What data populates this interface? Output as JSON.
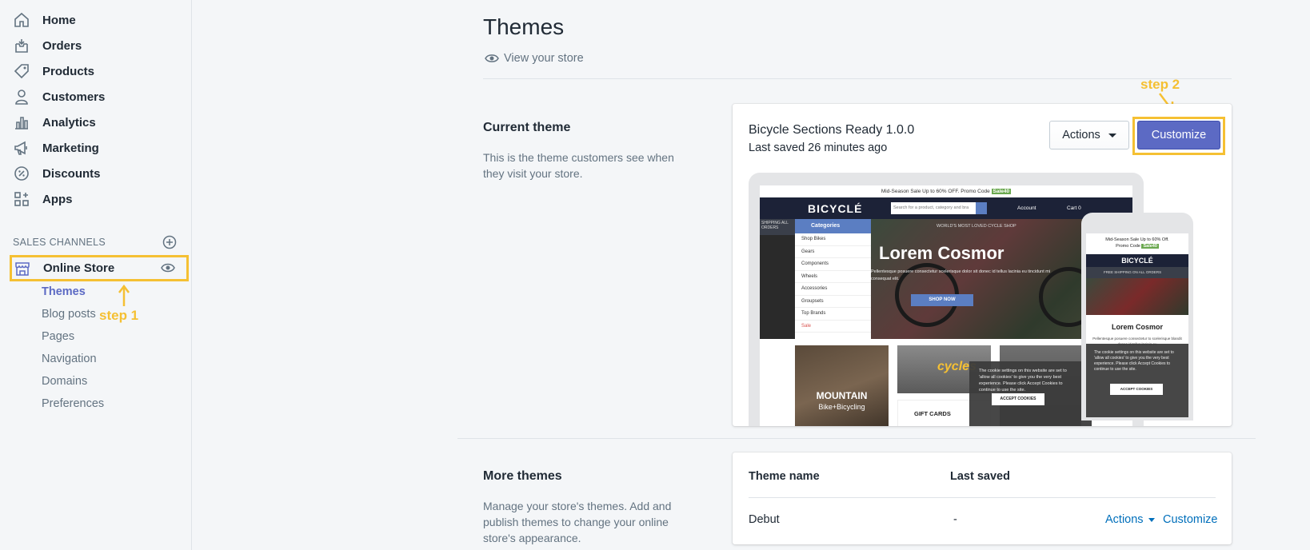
{
  "sidebar": {
    "items": [
      {
        "label": "Home",
        "icon": "home-icon"
      },
      {
        "label": "Orders",
        "icon": "orders-icon"
      },
      {
        "label": "Products",
        "icon": "tag-icon"
      },
      {
        "label": "Customers",
        "icon": "person-icon"
      },
      {
        "label": "Analytics",
        "icon": "bar-chart-icon"
      },
      {
        "label": "Marketing",
        "icon": "megaphone-icon"
      },
      {
        "label": "Discounts",
        "icon": "discount-icon"
      },
      {
        "label": "Apps",
        "icon": "apps-icon"
      }
    ],
    "sales_channels_label": "SALES CHANNELS",
    "online_store_label": "Online Store",
    "sub_items": [
      "Themes",
      "Blog posts",
      "Pages",
      "Navigation",
      "Domains",
      "Preferences"
    ],
    "active_sub": "Themes"
  },
  "annotations": {
    "step1": "step 1",
    "step2": "step 2",
    "color": "#f5c033"
  },
  "main": {
    "title": "Themes",
    "view_store": "View your store",
    "current": {
      "heading": "Current theme",
      "description": "This is the theme customers see when they visit your store.",
      "theme_name": "Bicycle Sections Ready 1.0.0",
      "last_saved": "Last saved 26 minutes ago",
      "actions_label": "Actions",
      "customize_label": "Customize"
    },
    "preview": {
      "promo": "Mid-Season Sale Up to 60% OFF. Promo Code",
      "promo_code": "Sale40",
      "logo": "BICYCLÉ",
      "search_placeholder": "Search for a product, category and bra",
      "account": "Account",
      "cart": "Cart",
      "cart_count": "0",
      "shipping": "SHIPPING ALL ORDERS",
      "categories_label": "Categories",
      "categories": [
        "Shop Bikes",
        "Gears",
        "Components",
        "Wheels",
        "Accessories",
        "Groupsets",
        "Top Brands",
        "Sale"
      ],
      "hero_tag": "WORLD'S MOST LOVED CYCLE SHOP",
      "hero_title": "Lorem Cosmor",
      "hero_sub": "Pellentesque posuere consectetur scelerisque dolor sit donec id tellus lacinia eu tincidunt mi consequat elit.",
      "shop_now": "SHOP NOW",
      "tile_mountain_1": "MOUNTAIN",
      "tile_mountain_2": "Bike+Bicycling",
      "tile_cycles": "cycles",
      "tile_gift": "GIFT CARDS",
      "cookie_text": "The cookie settings on this website are set to 'allow all cookies' to give you the very best experience. Please click Accept Cookies to continue to use the site.",
      "accept_cookies": "ACCEPT COOKIES",
      "mobile_promo_1": "Mid-Season Sale Up to 60% Off.",
      "mobile_promo_2": "Promo Code",
      "mobile_shipping": "FREE SHIPPING ON ALL ORDERS",
      "mobile_title": "Lorem Cosmor",
      "mobile_desc": "Pellentesque posuere consectetur to scelerisque blandit donec id tellus lacinia eu"
    },
    "more": {
      "heading": "More themes",
      "description": "Manage your store's themes. Add and publish themes to change your online store's appearance.",
      "columns": [
        "Theme name",
        "Last saved"
      ],
      "rows": [
        {
          "name": "Debut",
          "last_saved": "-",
          "actions": "Actions",
          "customize": "Customize"
        }
      ]
    }
  },
  "colors": {
    "accent": "#5c6ac4",
    "link": "#006fbb",
    "highlight": "#f5c033"
  }
}
